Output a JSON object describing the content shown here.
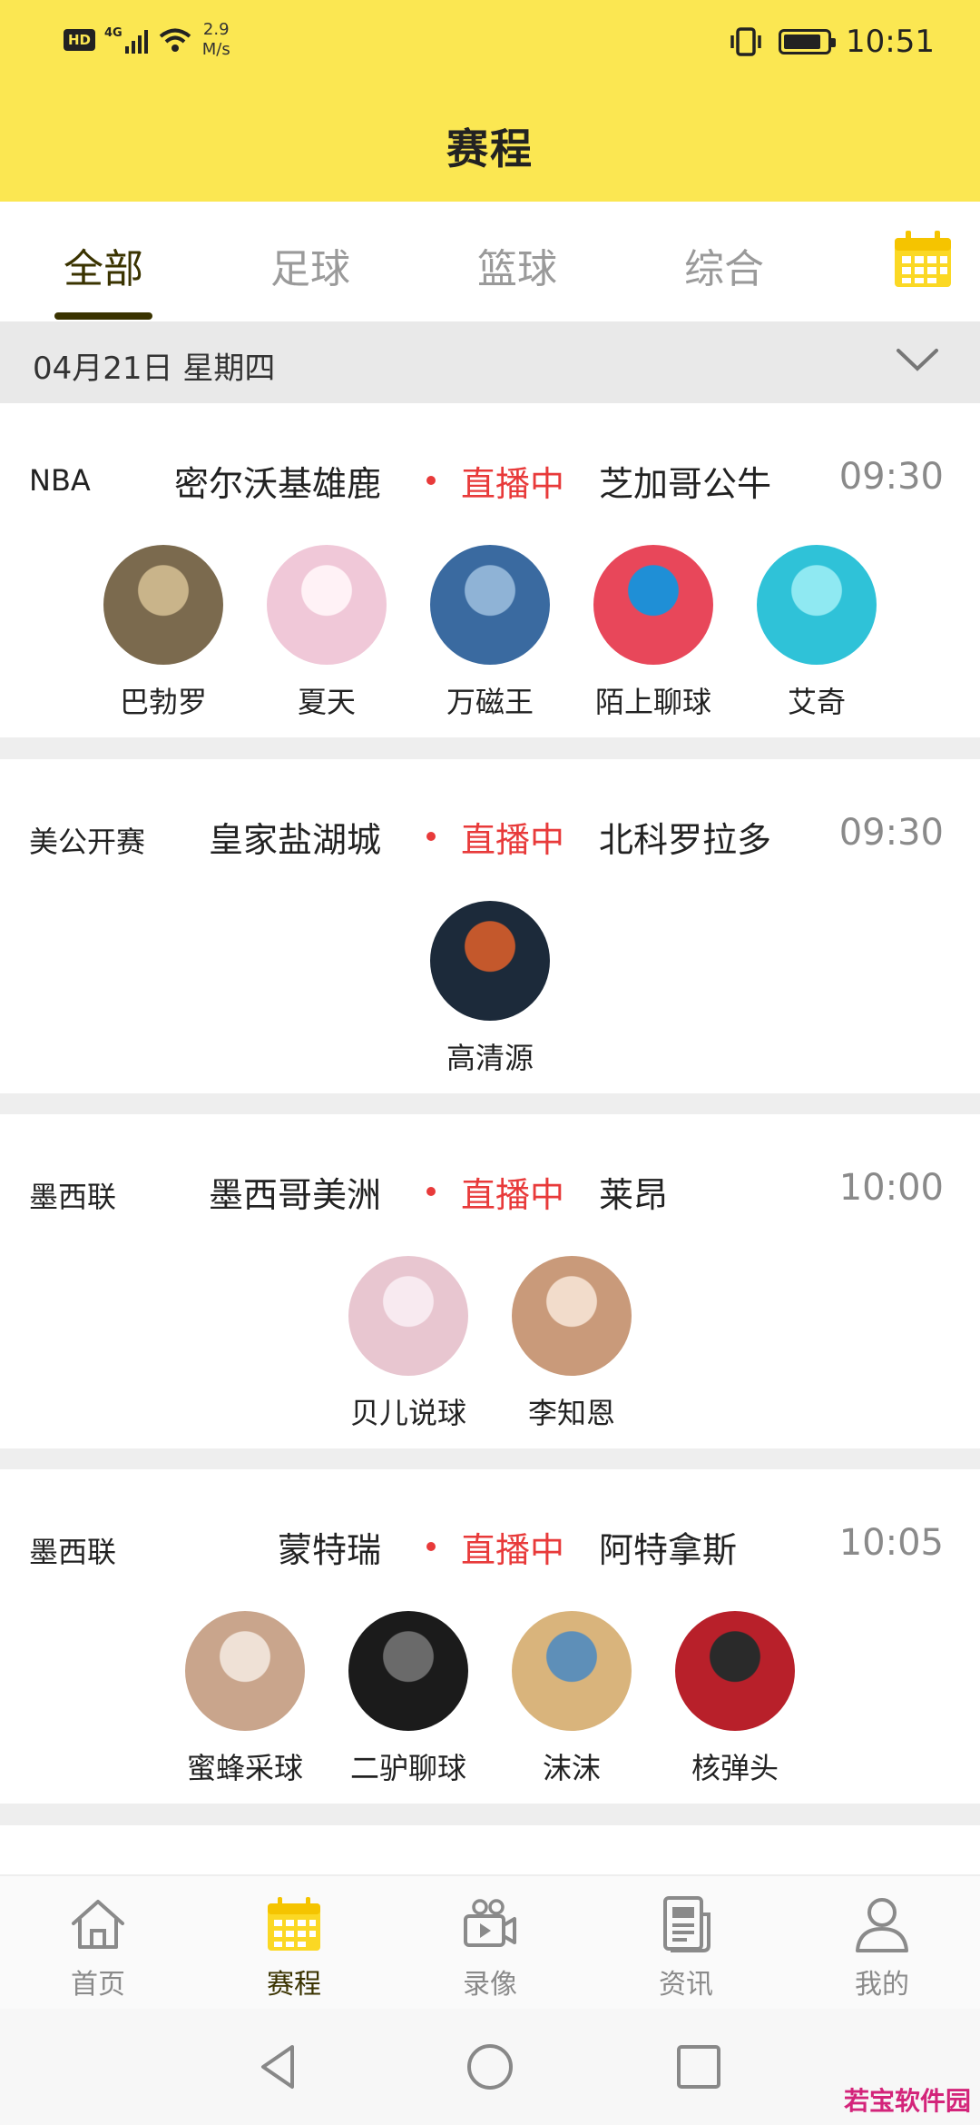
{
  "status_bar": {
    "hd": "HD",
    "network": "4G",
    "speed_value": "2.9",
    "speed_unit": "M/s",
    "time": "10:51"
  },
  "header": {
    "title": "赛程"
  },
  "tabs": [
    {
      "label": "全部",
      "active": true
    },
    {
      "label": "足球",
      "active": false
    },
    {
      "label": "篮球",
      "active": false
    },
    {
      "label": "综合",
      "active": false
    }
  ],
  "date_bar": {
    "label": "04月21日 星期四"
  },
  "matches": [
    {
      "league": "NBA",
      "home": "密尔沃基雄鹿",
      "status": "直播中",
      "away": "芝加哥公牛",
      "time": "09:30",
      "hosts": [
        "巴勃罗",
        "夏天",
        "万磁王",
        "陌上聊球",
        "艾奇"
      ]
    },
    {
      "league": "美公开赛",
      "home": "皇家盐湖城",
      "status": "直播中",
      "away": "北科罗拉多",
      "time": "09:30",
      "hosts": [
        "高清源"
      ]
    },
    {
      "league": "墨西联",
      "home": "墨西哥美洲",
      "status": "直播中",
      "away": "莱昂",
      "time": "10:00",
      "hosts": [
        "贝儿说球",
        "李知恩"
      ]
    },
    {
      "league": "墨西联",
      "home": "蒙特瑞",
      "status": "直播中",
      "away": "阿特拿斯",
      "time": "10:05",
      "hosts": [
        "蜜蜂采球",
        "二驴聊球",
        "沫沫",
        "核弹头"
      ]
    }
  ],
  "bottom_nav": [
    {
      "label": "首页",
      "icon": "home-icon",
      "active": false
    },
    {
      "label": "赛程",
      "icon": "calendar-icon",
      "active": true
    },
    {
      "label": "录像",
      "icon": "video-icon",
      "active": false
    },
    {
      "label": "资讯",
      "icon": "news-icon",
      "active": false
    },
    {
      "label": "我的",
      "icon": "profile-icon",
      "active": false
    }
  ],
  "watermark": "若宝软件园",
  "colors": {
    "accent_yellow": "#fbe752",
    "live_red": "#e83a3a",
    "active_text": "#3a3300",
    "inactive_text": "#9a9a9a"
  }
}
